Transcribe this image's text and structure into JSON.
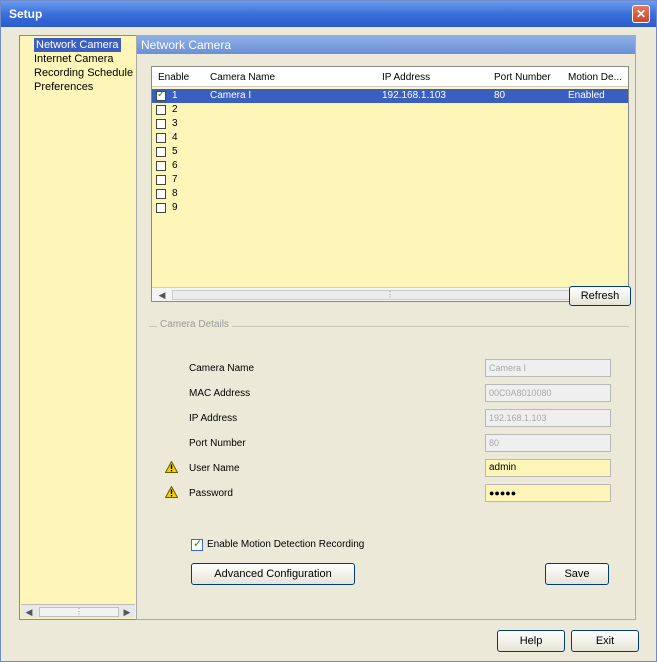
{
  "window": {
    "title": "Setup",
    "close_glyph": "✕"
  },
  "sidebar": {
    "items": [
      {
        "label": "Network Camera"
      },
      {
        "label": "Internet Camera"
      },
      {
        "label": "Recording Schedule"
      },
      {
        "label": "Preferences"
      }
    ],
    "scroll_left": "◀",
    "scroll_right": "▶",
    "scroll_thumb": "⋮"
  },
  "panel": {
    "header": "Network Camera"
  },
  "table": {
    "headers": [
      "Enable",
      "Camera Name",
      "IP Address",
      "Port Number",
      "Motion De..."
    ],
    "rows": [
      {
        "num": "1",
        "name": "Camera I",
        "ip": "192.168.1.103",
        "port": "80",
        "motion": "Enabled",
        "checked": true
      },
      {
        "num": "2"
      },
      {
        "num": "3"
      },
      {
        "num": "4"
      },
      {
        "num": "5"
      },
      {
        "num": "6"
      },
      {
        "num": "7"
      },
      {
        "num": "8"
      },
      {
        "num": "9"
      }
    ],
    "scroll_left": "◀",
    "scroll_right": "▶",
    "scroll_thumb": "⋮"
  },
  "refresh_label": "Refresh",
  "details": {
    "title": "Camera Details",
    "camera_name_label": "Camera Name",
    "camera_name_value": "Camera I",
    "mac_label": "MAC Address",
    "mac_value": "00C0A8010080",
    "ip_label": "IP Address",
    "ip_value": "192.168.1.103",
    "port_label": "Port Number",
    "port_value": "80",
    "user_label": "User Name",
    "user_value": "admin",
    "password_label": "Password",
    "password_value": "●●●●●"
  },
  "motion_checkbox_label": "Enable Motion Detection Recording",
  "advanced_label": "Advanced Configuration",
  "save_label": "Save",
  "help_label": "Help",
  "exit_label": "Exit",
  "colors": {
    "title_bar": "#3b6fd8",
    "selection": "#3a5fc0",
    "list_bg": "#fdf6b8",
    "window_bg": "#ece9d8"
  }
}
